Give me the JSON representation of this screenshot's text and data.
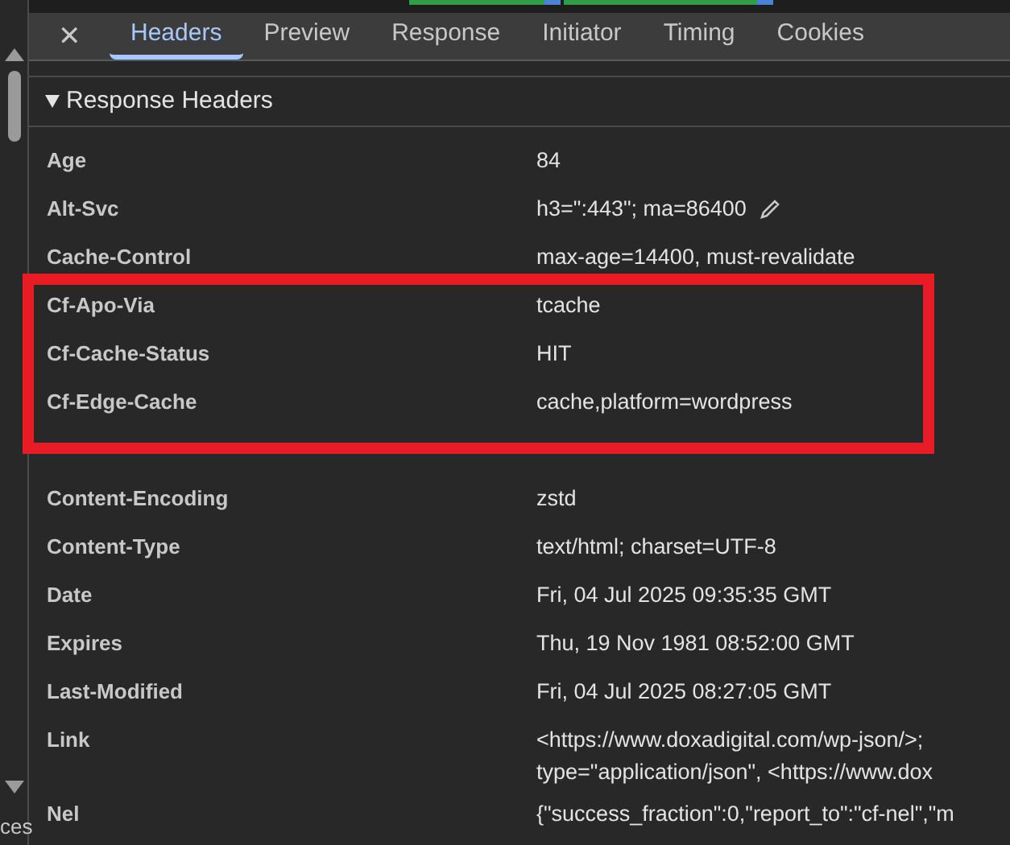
{
  "tabs": [
    {
      "label": "Headers",
      "selected": true
    },
    {
      "label": "Preview",
      "selected": false
    },
    {
      "label": "Response",
      "selected": false
    },
    {
      "label": "Initiator",
      "selected": false
    },
    {
      "label": "Timing",
      "selected": false
    },
    {
      "label": "Cookies",
      "selected": false
    }
  ],
  "close_symbol": "✕",
  "section": {
    "title": "Response Headers",
    "expanded": true,
    "headers": [
      {
        "name": "Age",
        "value": [
          "84"
        ],
        "editable": false
      },
      {
        "name": "Alt-Svc",
        "value": [
          "h3=\":443\"; ma=86400"
        ],
        "editable": true
      },
      {
        "name": "Cache-Control",
        "value": [
          "max-age=14400, must-revalidate"
        ],
        "editable": false
      },
      {
        "name": "Cf-Apo-Via",
        "value": [
          "tcache"
        ],
        "editable": false
      },
      {
        "name": "Cf-Cache-Status",
        "value": [
          "HIT"
        ],
        "editable": false
      },
      {
        "name": "Cf-Edge-Cache",
        "value": [
          "cache,platform=wordpress"
        ],
        "editable": false
      },
      {
        "kind": "covered"
      },
      {
        "name": "Content-Encoding",
        "value": [
          "zstd"
        ],
        "editable": false
      },
      {
        "name": "Content-Type",
        "value": [
          "text/html; charset=UTF-8"
        ],
        "editable": false
      },
      {
        "name": "Date",
        "value": [
          "Fri, 04 Jul 2025 09:35:35 GMT"
        ],
        "editable": false
      },
      {
        "name": "Expires",
        "value": [
          "Thu, 19 Nov 1981 08:52:00 GMT"
        ],
        "editable": false
      },
      {
        "name": "Last-Modified",
        "value": [
          "Fri, 04 Jul 2025 08:27:05 GMT"
        ],
        "editable": false
      },
      {
        "name": "Link",
        "value": [
          "<https://www.doxadigital.com/wp-json/>;",
          "type=\"application/json\", <https://www.dox"
        ],
        "editable": false
      },
      {
        "name": "Nel",
        "value": [
          "{\"success_fraction\":0,\"report_to\":\"cf-nel\",\"m"
        ],
        "editable": false
      }
    ]
  },
  "side_label": "ces"
}
